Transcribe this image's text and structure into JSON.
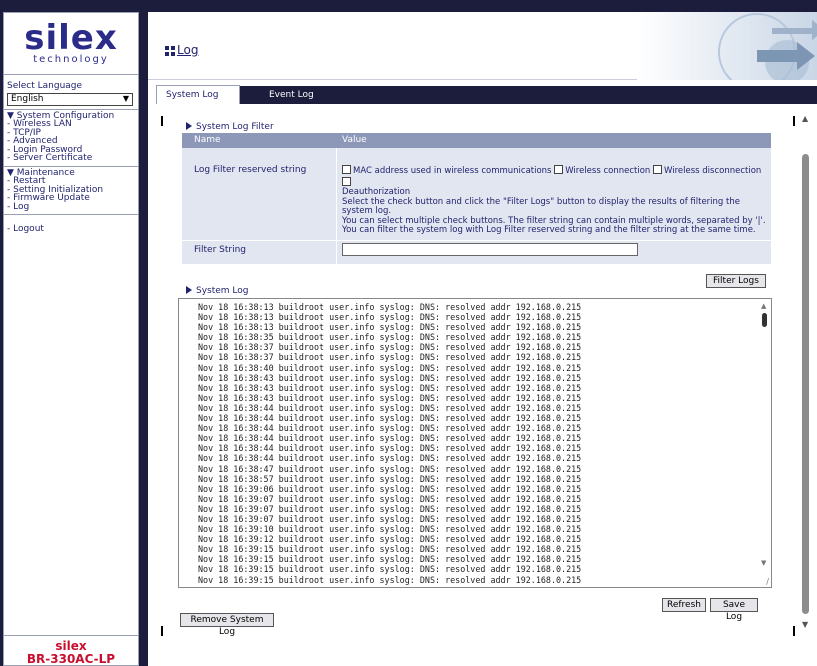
{
  "brand": {
    "logo": "silex",
    "logo_sub": "technology",
    "footer_line1": "silex",
    "footer_line2": "BR-330AC-LP"
  },
  "sidebar": {
    "language_label": "Select Language",
    "language_value": "English",
    "sections": [
      {
        "heading": "▼ System Configuration",
        "items": [
          "- Wireless LAN",
          "- TCP/IP",
          "- Advanced",
          "- Login Password",
          "- Server Certificate"
        ]
      },
      {
        "heading": "▼ Maintenance",
        "items": [
          "- Restart",
          "- Setting Initialization",
          "- Firmware Update",
          "- Log"
        ]
      }
    ],
    "logout": "- Logout"
  },
  "page": {
    "title": "Log"
  },
  "tabs": [
    {
      "label": "System Log",
      "active": true
    },
    {
      "label": "Event Log",
      "active": false
    }
  ],
  "filter": {
    "section_label": "System Log Filter",
    "col_name": "Name",
    "col_value": "Value",
    "reserved_label": "Log Filter reserved string",
    "checkboxes": [
      "MAC address used in wireless communications",
      "Wireless connection",
      "Wireless disconnection",
      "Deauthorization"
    ],
    "help_line1": "Select the check button and click the \"Filter Logs\" button to display the results of filtering the system log.",
    "help_line2": "You can select multiple check buttons. The filter string can contain multiple words, separated by '|'.",
    "help_line3": "You can filter the system log with Log Filter reserved string and the filter string at the same time.",
    "filter_string_label": "Filter String",
    "filter_string_value": "",
    "filter_button": "Filter Logs"
  },
  "system_log": {
    "section_label": "System Log",
    "lines": [
      "Nov 18 16:38:13 buildroot user.info syslog: DNS: resolved addr 192.168.0.215",
      "Nov 18 16:38:13 buildroot user.info syslog: DNS: resolved addr 192.168.0.215",
      "Nov 18 16:38:13 buildroot user.info syslog: DNS: resolved addr 192.168.0.215",
      "Nov 18 16:38:35 buildroot user.info syslog: DNS: resolved addr 192.168.0.215",
      "Nov 18 16:38:37 buildroot user.info syslog: DNS: resolved addr 192.168.0.215",
      "Nov 18 16:38:37 buildroot user.info syslog: DNS: resolved addr 192.168.0.215",
      "Nov 18 16:38:40 buildroot user.info syslog: DNS: resolved addr 192.168.0.215",
      "Nov 18 16:38:43 buildroot user.info syslog: DNS: resolved addr 192.168.0.215",
      "Nov 18 16:38:43 buildroot user.info syslog: DNS: resolved addr 192.168.0.215",
      "Nov 18 16:38:43 buildroot user.info syslog: DNS: resolved addr 192.168.0.215",
      "Nov 18 16:38:44 buildroot user.info syslog: DNS: resolved addr 192.168.0.215",
      "Nov 18 16:38:44 buildroot user.info syslog: DNS: resolved addr 192.168.0.215",
      "Nov 18 16:38:44 buildroot user.info syslog: DNS: resolved addr 192.168.0.215",
      "Nov 18 16:38:44 buildroot user.info syslog: DNS: resolved addr 192.168.0.215",
      "Nov 18 16:38:44 buildroot user.info syslog: DNS: resolved addr 192.168.0.215",
      "Nov 18 16:38:44 buildroot user.info syslog: DNS: resolved addr 192.168.0.215",
      "Nov 18 16:38:47 buildroot user.info syslog: DNS: resolved addr 192.168.0.215",
      "Nov 18 16:38:57 buildroot user.info syslog: DNS: resolved addr 192.168.0.215",
      "Nov 18 16:39:06 buildroot user.info syslog: DNS: resolved addr 192.168.0.215",
      "Nov 18 16:39:07 buildroot user.info syslog: DNS: resolved addr 192.168.0.215",
      "Nov 18 16:39:07 buildroot user.info syslog: DNS: resolved addr 192.168.0.215",
      "Nov 18 16:39:07 buildroot user.info syslog: DNS: resolved addr 192.168.0.215",
      "Nov 18 16:39:10 buildroot user.info syslog: DNS: resolved addr 192.168.0.215",
      "Nov 18 16:39:12 buildroot user.info syslog: DNS: resolved addr 192.168.0.215",
      "Nov 18 16:39:15 buildroot user.info syslog: DNS: resolved addr 192.168.0.215",
      "Nov 18 16:39:15 buildroot user.info syslog: DNS: resolved addr 192.168.0.215",
      "Nov 18 16:39:15 buildroot user.info syslog: DNS: resolved addr 192.168.0.215",
      "Nov 18 16:39:15 buildroot user.info syslog: DNS: resolved addr 192.168.0.215"
    ],
    "refresh_button": "Refresh",
    "save_button": "Save Log",
    "remove_button": "Remove System Log"
  },
  "colors": {
    "navy": "#1c1c3c",
    "text": "#22236e",
    "table_head": "#8d98b8",
    "table_body": "#e2e6f0",
    "brand_red": "#c8102e"
  }
}
